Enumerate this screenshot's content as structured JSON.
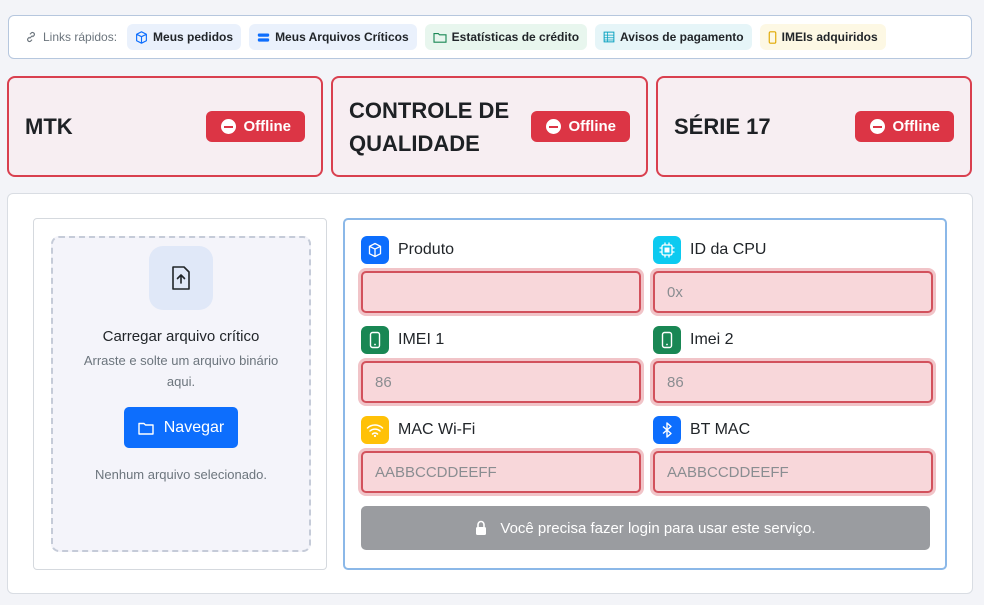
{
  "quick_links": {
    "label": "Links rápidos:",
    "items": [
      {
        "label": "Meus pedidos",
        "icon": "box-icon"
      },
      {
        "label": "Meus Arquivos Críticos",
        "icon": "database-icon"
      },
      {
        "label": "Estatísticas de crédito",
        "icon": "folder-icon"
      },
      {
        "label": "Avisos de pagamento",
        "icon": "table-icon"
      },
      {
        "label": "IMEIs adquiridos",
        "icon": "phone-icon"
      }
    ]
  },
  "services": [
    {
      "name": "MTK",
      "status": "Offline"
    },
    {
      "name": "CONTROLE DE QUALIDADE",
      "status": "Offline"
    },
    {
      "name": "SÉRIE 17",
      "status": "Offline"
    }
  ],
  "upload": {
    "title": "Carregar arquivo crítico",
    "subtitle": "Arraste e solte um arquivo binário aqui.",
    "browse_label": "Navegar",
    "empty_text": "Nenhum arquivo selecionado."
  },
  "form": {
    "fields": [
      {
        "label": "Produto",
        "placeholder": "",
        "value": "",
        "icon": "box-icon",
        "color": "#0d6efd"
      },
      {
        "label": "ID da CPU",
        "placeholder": "0x",
        "value": "",
        "icon": "cpu-icon",
        "color": "#0dcaf0"
      },
      {
        "label": "IMEI 1",
        "placeholder": "86",
        "value": "",
        "icon": "phone-icon",
        "color": "#198754"
      },
      {
        "label": "Imei 2",
        "placeholder": "86",
        "value": "",
        "icon": "phone-icon",
        "color": "#198754"
      },
      {
        "label": "MAC Wi-Fi",
        "placeholder": "AABBCCDDEEFF",
        "value": "",
        "icon": "wifi-icon",
        "color": "#ffc107"
      },
      {
        "label": "BT MAC",
        "placeholder": "AABBCCDDEEFF",
        "value": "",
        "icon": "bluetooth-icon",
        "color": "#0d6efd"
      }
    ],
    "login_message": "Você precisa fazer login para usar este serviço."
  },
  "colors": {
    "danger": "#dc3545",
    "primary": "#0d6efd",
    "disabled": "#9a9ca0"
  }
}
